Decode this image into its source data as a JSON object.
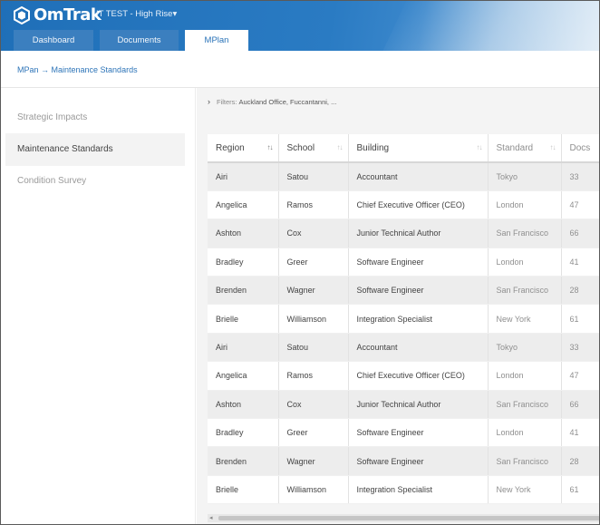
{
  "header": {
    "logo_text": "OmTrak",
    "project": "IT TEST - High Rise",
    "tabs": [
      {
        "label": "Dashboard"
      },
      {
        "label": "Documents"
      },
      {
        "label": "MPlan"
      }
    ]
  },
  "breadcrumb": "MPan → Maintenance Standards",
  "sidebar": {
    "items": [
      {
        "label": "Strategic Impacts"
      },
      {
        "label": "Maintenance Standards"
      },
      {
        "label": "Condition Survey"
      }
    ]
  },
  "filters": {
    "label": "Filters:",
    "value": "Auckland Office, Fuccantanni, ..."
  },
  "table": {
    "columns": [
      {
        "label": "Region"
      },
      {
        "label": "School"
      },
      {
        "label": "Building"
      },
      {
        "label": "Standard"
      },
      {
        "label": "Docs"
      }
    ],
    "rows": [
      [
        "Airi",
        "Satou",
        "Accountant",
        "Tokyo",
        "33"
      ],
      [
        "Angelica",
        "Ramos",
        "Chief Executive Officer (CEO)",
        "London",
        "47"
      ],
      [
        "Ashton",
        "Cox",
        "Junior Technical Author",
        "San Francisco",
        "66"
      ],
      [
        "Bradley",
        "Greer",
        "Software Engineer",
        "London",
        "41"
      ],
      [
        "Brenden",
        "Wagner",
        "Software Engineer",
        "San Francisco",
        "28"
      ],
      [
        "Brielle",
        "Williamson",
        "Integration Specialist",
        "New York",
        "61"
      ],
      [
        "Airi",
        "Satou",
        "Accountant",
        "Tokyo",
        "33"
      ],
      [
        "Angelica",
        "Ramos",
        "Chief Executive Officer (CEO)",
        "London",
        "47"
      ],
      [
        "Ashton",
        "Cox",
        "Junior Technical Author",
        "San Francisco",
        "66"
      ],
      [
        "Bradley",
        "Greer",
        "Software Engineer",
        "London",
        "41"
      ],
      [
        "Brenden",
        "Wagner",
        "Software Engineer",
        "San Francisco",
        "28"
      ],
      [
        "Brielle",
        "Williamson",
        "Integration Specialist",
        "New York",
        "61"
      ]
    ]
  },
  "icons": {
    "logo": "omtrak-logo-icon",
    "dropdown": "caret-down-icon",
    "filters_toggle": "chevron-right-icon",
    "sort": "sort-icon"
  },
  "colors": {
    "header": "#2a7bc3",
    "accent": "#2d74b8"
  }
}
